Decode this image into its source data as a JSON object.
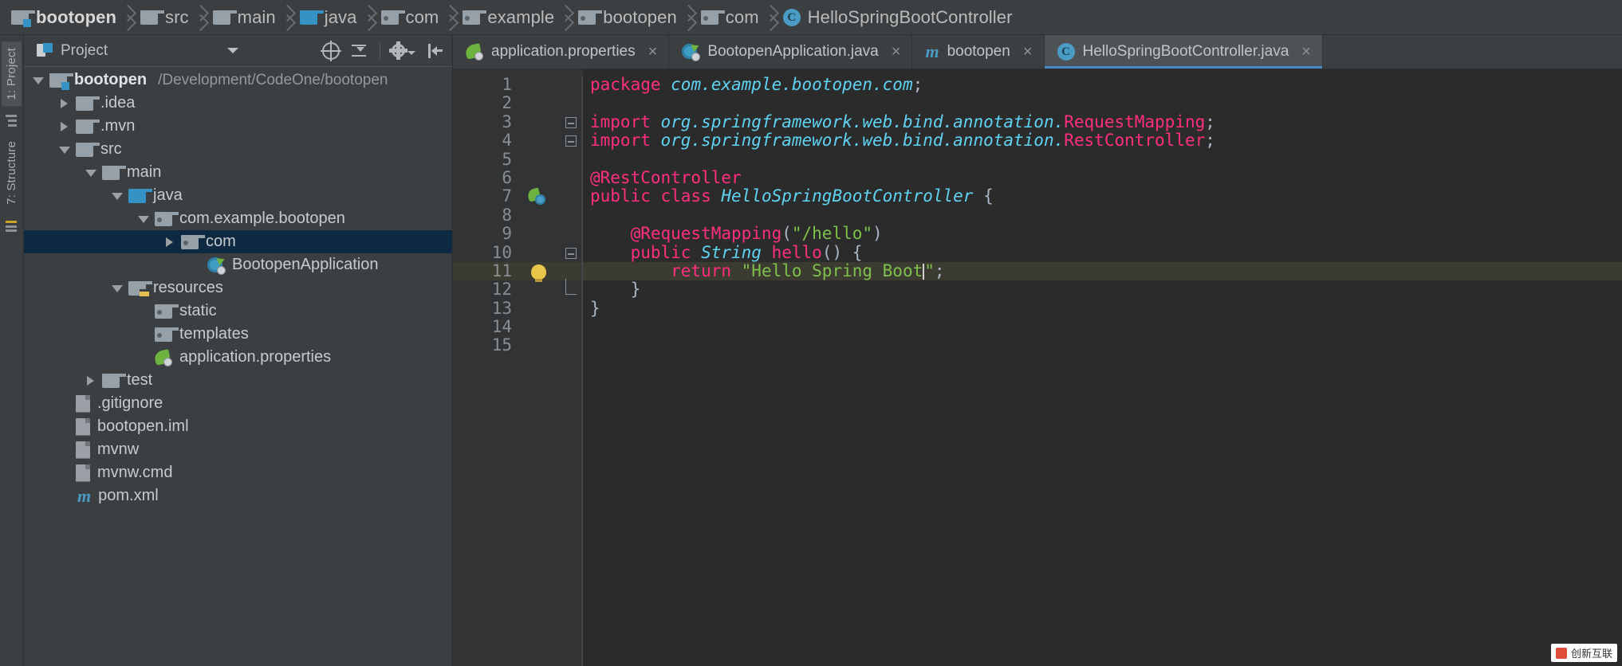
{
  "breadcrumb": {
    "items": [
      {
        "label": "bootopen",
        "icon": "module-folder-icon"
      },
      {
        "label": "src",
        "icon": "folder-icon"
      },
      {
        "label": "main",
        "icon": "folder-icon"
      },
      {
        "label": "java",
        "icon": "source-folder-icon"
      },
      {
        "label": "com",
        "icon": "package-folder-icon"
      },
      {
        "label": "example",
        "icon": "package-folder-icon"
      },
      {
        "label": "bootopen",
        "icon": "package-folder-icon"
      },
      {
        "label": "com",
        "icon": "package-folder-icon"
      },
      {
        "label": "HelloSpringBootController",
        "icon": "class-icon"
      }
    ]
  },
  "rail": {
    "project_tab": "1: Project",
    "structure_tab": "7: Structure",
    "favorites_icon": "favorites-icon"
  },
  "project_panel": {
    "title": "Project",
    "caret_icon": "chevron-down-icon",
    "tools": [
      {
        "name": "scroll-from-source-icon"
      },
      {
        "name": "collapse-all-icon"
      },
      {
        "name": "settings-gear-icon"
      },
      {
        "name": "hide-panel-icon"
      }
    ],
    "tree": [
      {
        "label": "bootopen",
        "path": "/Development/CodeOne/bootopen",
        "indent": 0,
        "arrow": "down",
        "icon": "module-folder-icon",
        "bold": true,
        "selected": false
      },
      {
        "label": ".idea",
        "path": "",
        "indent": 1,
        "arrow": "right",
        "icon": "folder-icon",
        "bold": false,
        "selected": false
      },
      {
        "label": ".mvn",
        "path": "",
        "indent": 1,
        "arrow": "right",
        "icon": "folder-icon",
        "bold": false,
        "selected": false
      },
      {
        "label": "src",
        "path": "",
        "indent": 1,
        "arrow": "down",
        "icon": "folder-icon",
        "bold": false,
        "selected": false
      },
      {
        "label": "main",
        "path": "",
        "indent": 2,
        "arrow": "down",
        "icon": "folder-icon",
        "bold": false,
        "selected": false
      },
      {
        "label": "java",
        "path": "",
        "indent": 3,
        "arrow": "down",
        "icon": "source-folder-icon",
        "bold": false,
        "selected": false
      },
      {
        "label": "com.example.bootopen",
        "path": "",
        "indent": 4,
        "arrow": "down",
        "icon": "package-folder-icon",
        "bold": false,
        "selected": false
      },
      {
        "label": "com",
        "path": "",
        "indent": 5,
        "arrow": "right",
        "icon": "package-folder-icon",
        "bold": false,
        "selected": true
      },
      {
        "label": "BootopenApplication",
        "path": "",
        "indent": 6,
        "arrow": "none",
        "icon": "springboot-class-icon",
        "bold": false,
        "selected": false
      },
      {
        "label": "resources",
        "path": "",
        "indent": 3,
        "arrow": "down",
        "icon": "resources-folder-icon",
        "bold": false,
        "selected": false
      },
      {
        "label": "static",
        "path": "",
        "indent": 4,
        "arrow": "none",
        "icon": "package-folder-icon",
        "bold": false,
        "selected": false
      },
      {
        "label": "templates",
        "path": "",
        "indent": 4,
        "arrow": "none",
        "icon": "package-folder-icon",
        "bold": false,
        "selected": false
      },
      {
        "label": "application.properties",
        "path": "",
        "indent": 4,
        "arrow": "none",
        "icon": "spring-properties-icon",
        "bold": false,
        "selected": false
      },
      {
        "label": "test",
        "path": "",
        "indent": 2,
        "arrow": "right",
        "icon": "folder-icon",
        "bold": false,
        "selected": false
      },
      {
        "label": ".gitignore",
        "path": "",
        "indent": 1,
        "arrow": "none",
        "icon": "file-icon",
        "bold": false,
        "selected": false
      },
      {
        "label": "bootopen.iml",
        "path": "",
        "indent": 1,
        "arrow": "none",
        "icon": "file-icon",
        "bold": false,
        "selected": false
      },
      {
        "label": "mvnw",
        "path": "",
        "indent": 1,
        "arrow": "none",
        "icon": "file-icon",
        "bold": false,
        "selected": false
      },
      {
        "label": "mvnw.cmd",
        "path": "",
        "indent": 1,
        "arrow": "none",
        "icon": "file-icon",
        "bold": false,
        "selected": false
      },
      {
        "label": "pom.xml",
        "path": "",
        "indent": 1,
        "arrow": "none",
        "icon": "maven-icon",
        "bold": false,
        "selected": false
      }
    ]
  },
  "editor": {
    "tabs": [
      {
        "label": "application.properties",
        "icon": "spring-properties-icon",
        "active": false,
        "close": "×"
      },
      {
        "label": "BootopenApplication.java",
        "icon": "springboot-class-icon",
        "active": false,
        "close": "×"
      },
      {
        "label": "bootopen",
        "icon": "maven-icon",
        "active": false,
        "close": "×"
      },
      {
        "label": "HelloSpringBootController.java",
        "icon": "class-icon",
        "active": true,
        "close": "×"
      }
    ],
    "line_numbers": [
      "1",
      "2",
      "3",
      "4",
      "5",
      "6",
      "7",
      "8",
      "9",
      "10",
      "11",
      "12",
      "13",
      "14",
      "15"
    ],
    "highlighted_line": 11,
    "gutter_marks": [
      {
        "line": 7,
        "icon": "spring-bean-icon"
      },
      {
        "line": 11,
        "icon": "intention-bulb-icon"
      }
    ],
    "fold_marks": [
      {
        "line": 3,
        "icon": "fold-collapse-icon"
      },
      {
        "line": 4,
        "icon": "fold-collapse-icon"
      },
      {
        "line": 10,
        "icon": "fold-collapse-icon"
      },
      {
        "line": 12,
        "icon": "fold-end-icon"
      }
    ],
    "code_lines": [
      {
        "n": 1,
        "tokens": [
          {
            "t": "package ",
            "c": "kw"
          },
          {
            "t": "com.example.bootopen.com",
            "c": "pkg"
          },
          {
            "t": ";",
            "c": "pn"
          }
        ]
      },
      {
        "n": 2,
        "tokens": []
      },
      {
        "n": 3,
        "tokens": [
          {
            "t": "import ",
            "c": "kw"
          },
          {
            "t": "org.springframework.web.bind.annotation.",
            "c": "pkg"
          },
          {
            "t": "RequestMapping",
            "c": "kw"
          },
          {
            "t": ";",
            "c": "pn"
          }
        ]
      },
      {
        "n": 4,
        "tokens": [
          {
            "t": "import ",
            "c": "kw"
          },
          {
            "t": "org.springframework.web.bind.annotation.",
            "c": "pkg"
          },
          {
            "t": "RestController",
            "c": "kw"
          },
          {
            "t": ";",
            "c": "pn"
          }
        ]
      },
      {
        "n": 5,
        "tokens": []
      },
      {
        "n": 6,
        "tokens": [
          {
            "t": "@RestController",
            "c": "ann"
          }
        ]
      },
      {
        "n": 7,
        "tokens": [
          {
            "t": "public class ",
            "c": "kw"
          },
          {
            "t": "HelloSpringBootController",
            "c": "cls"
          },
          {
            "t": " {",
            "c": "pn"
          }
        ]
      },
      {
        "n": 8,
        "tokens": []
      },
      {
        "n": 9,
        "tokens": [
          {
            "t": "    @RequestMapping",
            "c": "ann"
          },
          {
            "t": "(",
            "c": "pn"
          },
          {
            "t": "\"/hello\"",
            "c": "str"
          },
          {
            "t": ")",
            "c": "pn"
          }
        ]
      },
      {
        "n": 10,
        "tokens": [
          {
            "t": "    public ",
            "c": "kw"
          },
          {
            "t": "String",
            "c": "cls"
          },
          {
            "t": " ",
            "c": "pn"
          },
          {
            "t": "hello",
            "c": "kw"
          },
          {
            "t": "() {",
            "c": "pn"
          }
        ]
      },
      {
        "n": 11,
        "tokens": [
          {
            "t": "        return ",
            "c": "kw"
          },
          {
            "t": "\"Hello Spring Boot",
            "c": "str"
          },
          {
            "t": "|CURSOR|",
            "c": "cur"
          },
          {
            "t": "\"",
            "c": "str"
          },
          {
            "t": ";",
            "c": "pn"
          }
        ]
      },
      {
        "n": 12,
        "tokens": [
          {
            "t": "    }",
            "c": "pn"
          }
        ]
      },
      {
        "n": 13,
        "tokens": [
          {
            "t": "}",
            "c": "pn"
          }
        ]
      },
      {
        "n": 14,
        "tokens": []
      },
      {
        "n": 15,
        "tokens": []
      }
    ]
  },
  "watermark": {
    "text": "创新互联"
  }
}
